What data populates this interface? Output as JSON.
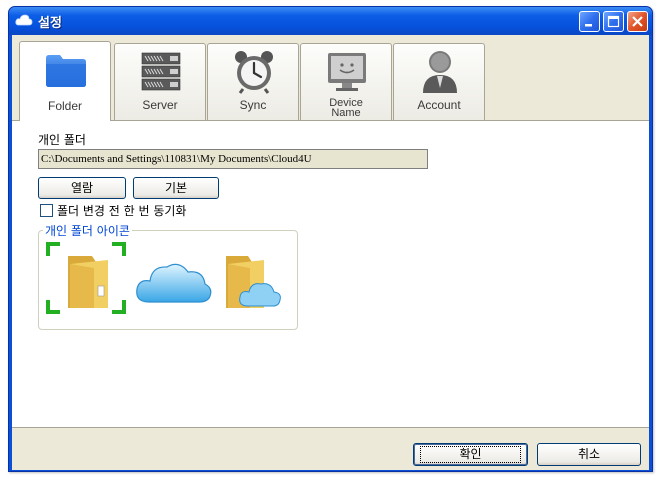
{
  "window": {
    "title": "설정",
    "controls": [
      "minimize-icon",
      "maximize-icon",
      "close-icon"
    ]
  },
  "tabs": [
    {
      "label": "Folder",
      "icon": "folder-icon",
      "active": true
    },
    {
      "label": "Server",
      "icon": "server-icon",
      "active": false
    },
    {
      "label": "Sync",
      "icon": "alarm-clock-icon",
      "active": false
    },
    {
      "label": "Device\nName",
      "label_line1": "Device",
      "label_line2": "Name",
      "icon": "monitor-icon",
      "active": false
    },
    {
      "label": "Account",
      "icon": "user-icon",
      "active": false
    }
  ],
  "folder": {
    "label": "개인 폴더",
    "path": "C:\\Documents and Settings\\110831\\My Documents\\Cloud4U",
    "open_button": "열람",
    "default_button": "기본",
    "sync_checkbox_label": "폴더 변경 전 한 번 동기화",
    "sync_checkbox_checked": false
  },
  "icon_group": {
    "title": "개인 폴더 아이콘",
    "icons": [
      "folder-icon",
      "cloud-icon",
      "cloud-folder-icon"
    ],
    "selected_index": 0
  },
  "footer": {
    "ok_button": "확인",
    "cancel_button": "취소"
  },
  "colors": {
    "titlebar": "#0a4fd6",
    "dialog_bg": "#ece9d8",
    "group_title": "#0046d5",
    "selection": "#22b022",
    "path_bg": "#e7e4cf"
  }
}
